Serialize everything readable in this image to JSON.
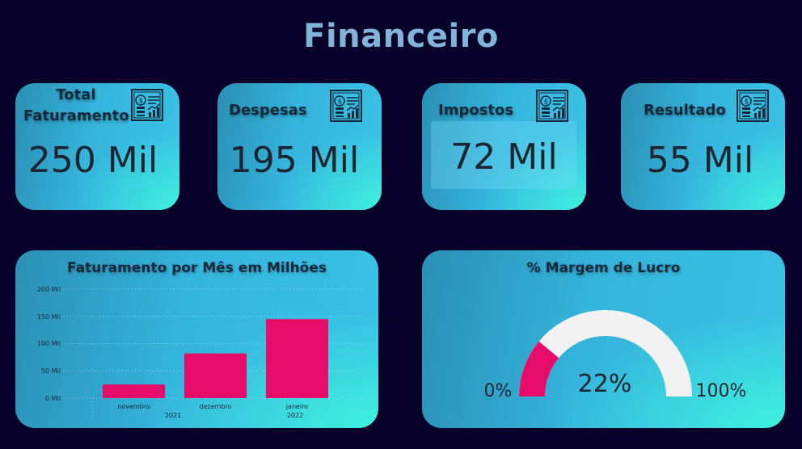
{
  "header": {
    "title": "Financeiro"
  },
  "kpis": [
    {
      "label": "Total Faturamento",
      "value": "250 Mil",
      "icon": "financial-report-icon"
    },
    {
      "label": "Despesas",
      "value": "195 Mil",
      "icon": "financial-report-icon"
    },
    {
      "label": "Impostos",
      "value": "72 Mil",
      "icon": "financial-report-icon"
    },
    {
      "label": "Resultado",
      "value": "55 Mil",
      "icon": "financial-report-icon"
    }
  ],
  "revenue_chart": {
    "title": "Faturamento por Mês em Milhões",
    "y_ticks": [
      "200 Mil",
      "150 Mil",
      "100 Mil",
      "50 Mil",
      "0 Mil"
    ],
    "year_labels": [
      "2021",
      "2022"
    ]
  },
  "margin_gauge": {
    "title": "% Margem de Lucro",
    "value_label": "22%",
    "min_label": "0%",
    "max_label": "100%",
    "value": 22
  },
  "colors": {
    "background": "#08022a",
    "bar": "#e60d6a",
    "gauge_fill": "#e60d6a",
    "gauge_track": "#f2f2f2",
    "title": "#82b4d8"
  },
  "chart_data": {
    "type": "bar",
    "title": "Faturamento por Mês em Milhões",
    "categories": [
      "novembro",
      "dezembro",
      "janeiro"
    ],
    "category_years": [
      "2021",
      "2021",
      "2022"
    ],
    "values": [
      25,
      82,
      145
    ],
    "ylim": [
      0,
      200
    ],
    "ytick_values": [
      0,
      50,
      100,
      150,
      200
    ],
    "grid": true,
    "xlabel": "",
    "ylabel": ""
  }
}
